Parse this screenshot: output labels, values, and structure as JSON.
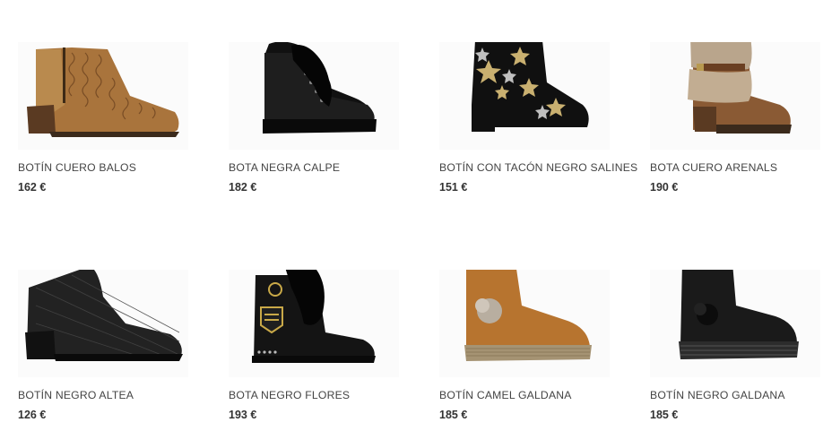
{
  "products": [
    {
      "name": "BOTÍN CUERO BALOS",
      "price": "162 €",
      "icon": "boot-brown-pattern-icon"
    },
    {
      "name": "BOTA NEGRA CALPE",
      "price": "182 €",
      "icon": "boot-black-fur-laceup-icon"
    },
    {
      "name": "BOTÍN CON TACÓN NEGRO SALINES",
      "price": "151 €",
      "icon": "boot-black-stars-icon"
    },
    {
      "name": "BOTA CUERO ARENALS",
      "price": "190 €",
      "icon": "boot-brown-fur-icon"
    },
    {
      "name": "BOTÍN NEGRO ALTEA",
      "price": "126 €",
      "icon": "boot-black-textured-icon"
    },
    {
      "name": "BOTA NEGRO FLORES",
      "price": "193 €",
      "icon": "boot-black-fur-badge-icon"
    },
    {
      "name": "BOTÍN CAMEL GALDANA",
      "price": "185 €",
      "icon": "boot-camel-pompom-icon"
    },
    {
      "name": "BOTÍN NEGRO GALDANA",
      "price": "185 €",
      "icon": "boot-black-pompom-icon"
    }
  ],
  "colors": {
    "text": "#444444",
    "price": "#333333",
    "background": "#ffffff"
  }
}
